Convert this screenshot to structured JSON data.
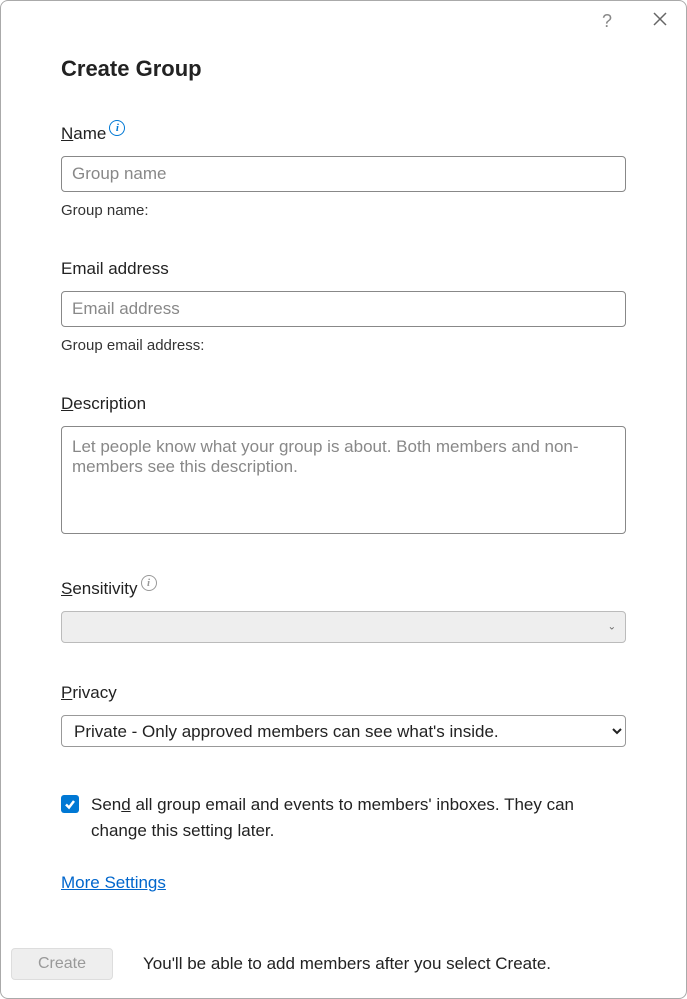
{
  "dialog": {
    "title": "Create Group"
  },
  "fields": {
    "name": {
      "label_pre": "N",
      "label_post": "ame",
      "placeholder": "Group name",
      "hint": "Group name:"
    },
    "email": {
      "label": "Email address",
      "placeholder": "Email address",
      "hint": "Group email address:"
    },
    "description": {
      "label_pre": "D",
      "label_post": "escription",
      "placeholder": "Let people know what your group is about. Both members and non-members see this description."
    },
    "sensitivity": {
      "label_pre": "S",
      "label_post": "ensitivity",
      "value": ""
    },
    "privacy": {
      "label_pre": "P",
      "label_post": "rivacy",
      "selected": "Private - Only approved members can see what's inside."
    },
    "sendAll": {
      "checked": true,
      "label_pre": "Sen",
      "label_u": "d",
      "label_post": " all group email and events to members' inboxes. They can change this setting later."
    }
  },
  "moreSettings": "More Settings",
  "footer": {
    "createLabel": "Create",
    "text": "You'll be able to add members after you select Create."
  }
}
